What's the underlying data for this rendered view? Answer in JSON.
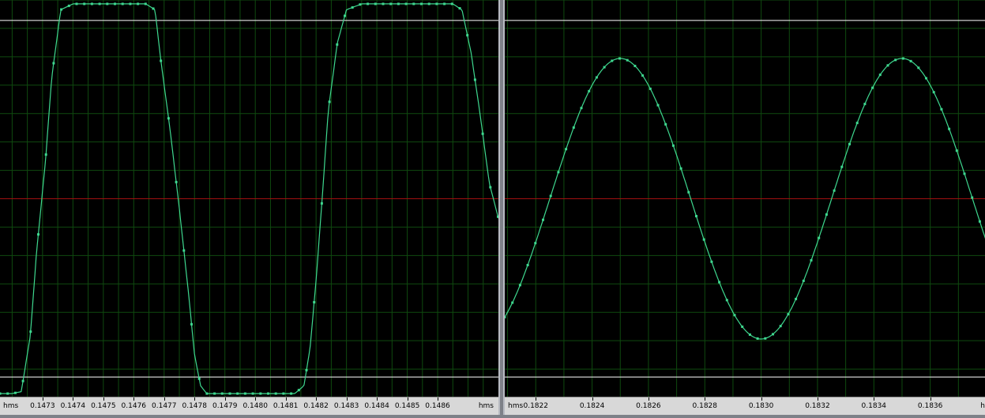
{
  "colors": {
    "background": "#000000",
    "grid": "#0f4a0f",
    "zero_line": "#a01010",
    "clip_line": "#ffffff",
    "trace": "#3ed88f",
    "axis_bar": "#d8d8d8"
  },
  "left_panel": {
    "unit_left": "hms",
    "unit_right": "hms"
  },
  "right_panel": {
    "unit_left": "hms",
    "unit_right": "h"
  },
  "chart_data": [
    {
      "type": "line",
      "title": "",
      "xlabel": "hms",
      "ylabel": "",
      "xlim": [
        0.14716,
        0.1488
      ],
      "ylim": [
        -1.02,
        1.02
      ],
      "clip_lines": [
        0.915,
        -0.915
      ],
      "zero_line": 0,
      "grid": true,
      "x_ticks": [
        "0.1473",
        "0.1474",
        "0.1475",
        "0.1476",
        "0.1477",
        "0.1478",
        "0.1479",
        "0.1480",
        "0.1481",
        "0.1482",
        "0.1483",
        "0.1484",
        "0.1485",
        "0.1486"
      ],
      "x_tick_values": [
        0.1473,
        0.1474,
        0.1475,
        0.1476,
        0.1477,
        0.1478,
        0.1479,
        0.148,
        0.1481,
        0.1482,
        0.1483,
        0.1484,
        0.1485,
        0.1486
      ],
      "series": [
        {
          "x": [
            0.14716,
            0.1472,
            0.14723,
            0.14726,
            0.14728,
            0.14731,
            0.14733,
            0.14736,
            0.1474,
            0.14745,
            0.1475,
            0.14755,
            0.1476,
            0.14764,
            0.14767,
            0.14769,
            0.14772,
            0.14775,
            0.14778,
            0.1478,
            0.14782,
            0.14784,
            0.14786,
            0.14788,
            0.14791,
            0.14796,
            0.14801,
            0.14806,
            0.1481,
            0.14813,
            0.14816,
            0.14818,
            0.1482,
            0.14822,
            0.14824,
            0.14827,
            0.1483,
            0.14835,
            0.1484,
            0.14845,
            0.1485,
            0.14855,
            0.1486,
            0.14865,
            0.14868,
            0.14871,
            0.14874,
            0.14877,
            0.1488
          ],
          "y": [
            -1.0,
            -1.0,
            -0.99,
            -0.7,
            -0.28,
            0.2,
            0.62,
            0.97,
            1.0,
            1.0,
            1.0,
            1.0,
            1.0,
            1.0,
            0.97,
            0.7,
            0.35,
            -0.05,
            -0.48,
            -0.8,
            -0.96,
            -1.0,
            -1.0,
            -1.0,
            -1.0,
            -1.0,
            -1.0,
            -1.0,
            -1.0,
            -1.0,
            -0.96,
            -0.77,
            -0.42,
            0.0,
            0.45,
            0.8,
            0.97,
            1.0,
            1.0,
            1.0,
            1.0,
            1.0,
            1.0,
            1.0,
            0.97,
            0.75,
            0.43,
            0.08,
            -0.1
          ]
        }
      ]
    },
    {
      "type": "line",
      "title": "",
      "xlabel": "hms",
      "ylabel": "",
      "xlim": [
        0.18209,
        0.1838
      ],
      "ylim": [
        -1.02,
        1.02
      ],
      "clip_lines": [
        0.915,
        -0.915
      ],
      "zero_line": 0,
      "grid": true,
      "x_ticks": [
        "0.1822",
        "0.1824",
        "0.1826",
        "0.1828",
        "0.1830",
        "0.1832",
        "0.1834",
        "0.1836"
      ],
      "x_tick_values": [
        0.1822,
        0.1824,
        0.1826,
        0.1828,
        0.183,
        0.1832,
        0.1834,
        0.1836
      ],
      "sine": {
        "amplitude": 0.72,
        "period": 0.001,
        "peak_at": 0.1825,
        "offset": 0.0
      }
    }
  ]
}
